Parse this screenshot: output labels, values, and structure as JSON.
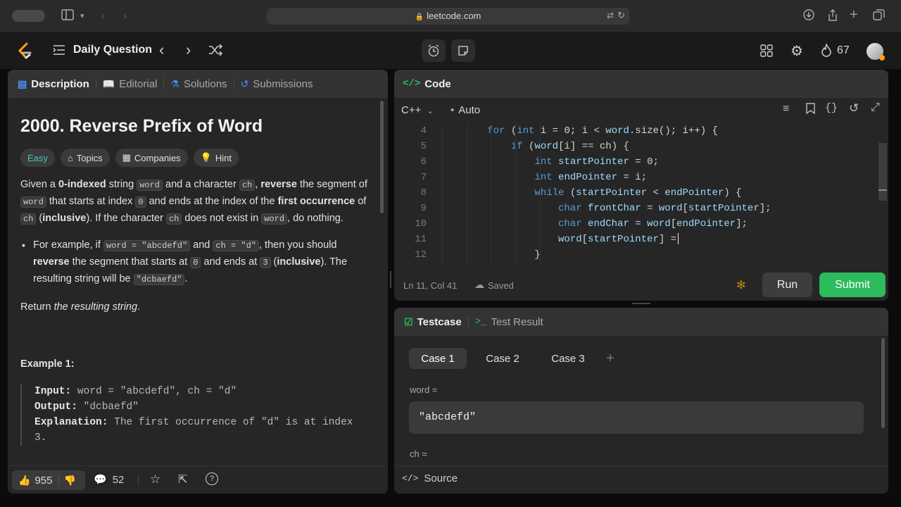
{
  "browser": {
    "url": "leetcode.com"
  },
  "appbar": {
    "title": "Daily Question",
    "streak": "67"
  },
  "left_panel": {
    "tabs": [
      {
        "label": "Description"
      },
      {
        "label": "Editorial"
      },
      {
        "label": "Solutions"
      },
      {
        "label": "Submissions"
      }
    ],
    "problem_title": "2000. Reverse Prefix of Word",
    "tags": {
      "difficulty": "Easy",
      "topics": "Topics",
      "companies": "Companies",
      "hint": "Hint"
    },
    "para1": {
      "t1": "Given a ",
      "b1": "0-indexed",
      "t2": " string ",
      "c1": "word",
      "t3": " and a character ",
      "c2": "ch",
      "t4": ", ",
      "b2": "reverse",
      "t5": " the segment of ",
      "c3": "word",
      "t6": " that starts at index ",
      "c4": "0",
      "t7": " and ends at the index of the ",
      "b3": "first occurrence",
      "t8": " of ",
      "c5": "ch",
      "t9": " (",
      "b4": "inclusive",
      "t10": "). If the character ",
      "c6": "ch",
      "t11": " does not exist in ",
      "c7": "word",
      "t12": ", do nothing."
    },
    "bullet": {
      "t1": "For example, if ",
      "c1": "word = \"abcdefd\"",
      "t2": " and ",
      "c2": "ch = \"d\"",
      "t3": ", then you should ",
      "b1": "reverse",
      "t4": " the segment that starts at ",
      "c3": "0",
      "t5": " and ends at ",
      "c4": "3",
      "t6": " (",
      "b2": "inclusive",
      "t7": "). The resulting string will be ",
      "c5": "\"dcbaefd\"",
      "t8": "."
    },
    "return_line": {
      "t1": "Return ",
      "i1": "the resulting string",
      "t2": "."
    },
    "example1": {
      "heading": "Example 1:",
      "input_label": "Input:",
      "input_value": "word = \"abcdefd\", ch = \"d\"",
      "output_label": "Output:",
      "output_value": "\"dcbaefd\"",
      "explanation_label": "Explanation:",
      "explanation_value": "The first occurrence of \"d\" is at index 3."
    },
    "footer": {
      "likes": "955",
      "comments": "52"
    }
  },
  "code_panel": {
    "title": "Code",
    "language": "C++",
    "mode": "Auto",
    "lines": [
      {
        "n": "4",
        "text": "        for (int i = 0; i < word.size(); i++) {"
      },
      {
        "n": "5",
        "text": "            if (word[i] == ch) {"
      },
      {
        "n": "6",
        "text": "                int startPointer = 0;"
      },
      {
        "n": "7",
        "text": "                int endPointer = i;"
      },
      {
        "n": "8",
        "text": "                while (startPointer < endPointer) {"
      },
      {
        "n": "9",
        "text": "                    char frontChar = word[startPointer];"
      },
      {
        "n": "10",
        "text": "                    char endChar = word[endPointer];"
      },
      {
        "n": "11",
        "text": "                    word[startPointer] ="
      },
      {
        "n": "12",
        "text": "                }"
      }
    ],
    "status": "Ln 11, Col 41",
    "saved": "Saved",
    "run_label": "Run",
    "submit_label": "Submit"
  },
  "test_panel": {
    "tabs": [
      {
        "label": "Testcase"
      },
      {
        "label": "Test Result"
      }
    ],
    "cases": [
      {
        "label": "Case 1"
      },
      {
        "label": "Case 2"
      },
      {
        "label": "Case 3"
      }
    ],
    "word_label": "word =",
    "word_value": "\"abcdefd\"",
    "ch_label": "ch =",
    "source_label": "Source"
  },
  "colors": {
    "accent_green": "#2cbb5d",
    "easy": "#46c6c2",
    "brand_orange": "#ffa116"
  }
}
